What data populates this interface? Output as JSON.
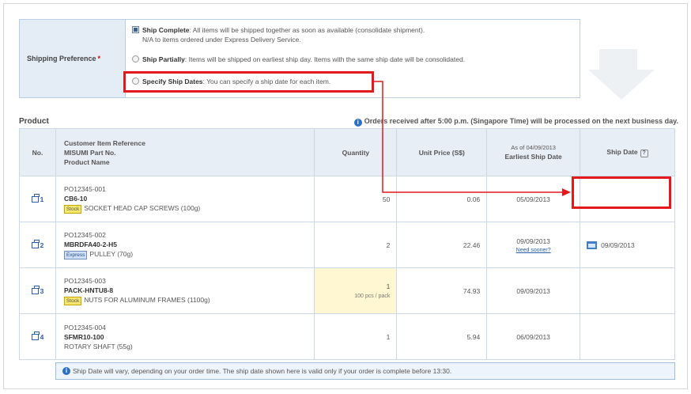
{
  "shipping": {
    "label": "Shipping Preference",
    "required_mark": "*",
    "options": [
      {
        "title": "Ship Complete",
        "text": ": All items will be shipped together as soon as available (consolidate shipment).",
        "sub": "N/A to items ordered under Express Delivery Service.",
        "checked": true
      },
      {
        "title": "Ship Partially",
        "text": ": Items will be shipped on earliest ship day. Items with the same ship date will be consolidated.",
        "checked": false
      },
      {
        "title": "Specify Ship Dates",
        "text": ": You can specify a ship date for each item.",
        "checked": false
      }
    ]
  },
  "product": {
    "title": "Product",
    "notice": "Orders received after 5:00 p.m. (Singapore Time) will be processed on the next business day."
  },
  "table": {
    "headers": {
      "no": "No.",
      "product_line1": "Customer Item Reference",
      "product_line2": "MISUMI Part No.",
      "product_line3": "Product Name",
      "quantity": "Quantity",
      "unit_price": "Unit Price (S$)",
      "esd_top": "As of 04/09/2013",
      "esd": "Earliest Ship Date",
      "ship_date": "Ship Date",
      "help": "?"
    },
    "rows": [
      {
        "no": "1",
        "ref": "PO12345-001",
        "part": "CB6-10",
        "tag": "Stock",
        "name": "SOCKET HEAD CAP SCREWS (100g)",
        "qty": "50",
        "price": "0.06",
        "esd": "05/09/2013",
        "ship": ""
      },
      {
        "no": "2",
        "ref": "PO12345-002",
        "part": "MBRDFA40-2-H5",
        "tag": "Express",
        "name": "PULLEY (70g)",
        "qty": "2",
        "price": "22.46",
        "esd": "09/09/2013",
        "need_sooner": "Need sooner?",
        "ship": "09/09/2013"
      },
      {
        "no": "3",
        "ref": "PO12345-003",
        "part": "PACK-HNTU8-8",
        "tag": "Stock",
        "name": "NUTS FOR ALUMINUM FRAMES (1100g)",
        "qty": "1",
        "per_pack": "100 pcs / pack",
        "price": "74.93",
        "esd": "09/09/2013",
        "ship": ""
      },
      {
        "no": "4",
        "ref": "PO12345-004",
        "part": "SFMR10-100",
        "tag": "",
        "name": "ROTARY SHAFT (55g)",
        "qty": "1",
        "price": "5.94",
        "esd": "06/09/2013",
        "ship": ""
      }
    ]
  },
  "footer_note": "Ship Date will vary, depending on your order time. The ship date shown here is valid only if your order is complete before 13:30.",
  "colors": {
    "highlight": "#e3191c",
    "link": "#2a5ea8",
    "header_bg": "#e8eef6"
  }
}
